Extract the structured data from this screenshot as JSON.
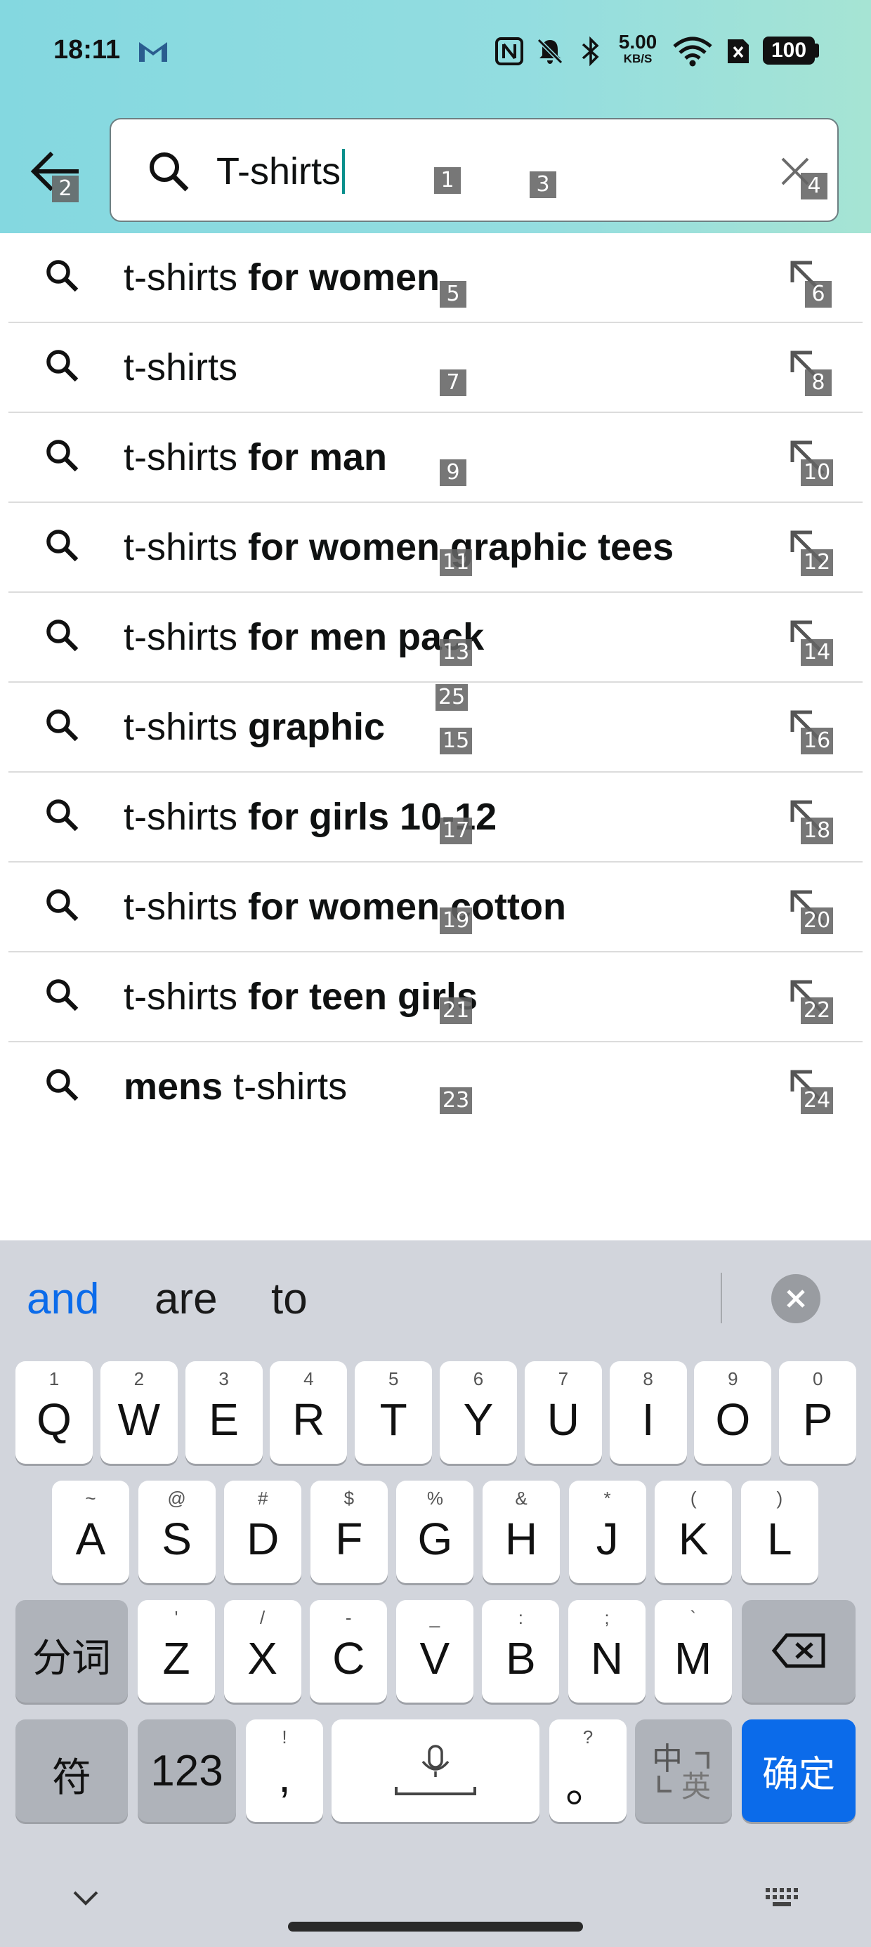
{
  "status_bar": {
    "time": "18:11",
    "speed_value": "5.00",
    "speed_unit": "KB/S",
    "battery": "100",
    "icons": [
      "gmail-icon",
      "nfc-icon",
      "mute-icon",
      "bluetooth-icon",
      "wifi-icon",
      "sim-icon",
      "battery-icon"
    ]
  },
  "search": {
    "query": "T-shirts",
    "back_icon": "back-arrow-icon",
    "search_icon": "search-icon",
    "clear_icon": "close-icon"
  },
  "suggestions": [
    {
      "plain": "t-shirts ",
      "bold": "for women"
    },
    {
      "plain": "t-shirts",
      "bold": ""
    },
    {
      "plain": "t-shirts ",
      "bold": "for man"
    },
    {
      "plain": "t-shirts ",
      "bold": "for women graphic tees"
    },
    {
      "plain": "t-shirts ",
      "bold": "for men pack"
    },
    {
      "plain": "t-shirts ",
      "bold": "graphic"
    },
    {
      "plain": "t-shirts ",
      "bold": "for girls 10-12"
    },
    {
      "plain": "t-shirts ",
      "bold": "for women cotton"
    },
    {
      "plain": "t-shirts ",
      "bold": "for teen girls"
    },
    {
      "bold_first": "mens ",
      "plain_after": "t-shirts"
    }
  ],
  "tags": [
    "1",
    "2",
    "3",
    "4",
    "5",
    "6",
    "7",
    "8",
    "9",
    "10",
    "11",
    "12",
    "13",
    "14",
    "15",
    "16",
    "17",
    "18",
    "19",
    "20",
    "21",
    "22",
    "23",
    "24",
    "25"
  ],
  "keyboard": {
    "candidates": [
      "and",
      "are",
      "to"
    ],
    "row1": [
      {
        "k": "Q",
        "s": "1"
      },
      {
        "k": "W",
        "s": "2"
      },
      {
        "k": "E",
        "s": "3"
      },
      {
        "k": "R",
        "s": "4"
      },
      {
        "k": "T",
        "s": "5"
      },
      {
        "k": "Y",
        "s": "6"
      },
      {
        "k": "U",
        "s": "7"
      },
      {
        "k": "I",
        "s": "8"
      },
      {
        "k": "O",
        "s": "9"
      },
      {
        "k": "P",
        "s": "0"
      }
    ],
    "row2": [
      {
        "k": "A",
        "s": "~"
      },
      {
        "k": "S",
        "s": "@"
      },
      {
        "k": "D",
        "s": "#"
      },
      {
        "k": "F",
        "s": "$"
      },
      {
        "k": "G",
        "s": "%"
      },
      {
        "k": "H",
        "s": "&"
      },
      {
        "k": "J",
        "s": "*"
      },
      {
        "k": "K",
        "s": "("
      },
      {
        "k": "L",
        "s": ")"
      }
    ],
    "row3": [
      {
        "k": "Z",
        "s": "'"
      },
      {
        "k": "X",
        "s": "/"
      },
      {
        "k": "C",
        "s": "-"
      },
      {
        "k": "V",
        "s": "_"
      },
      {
        "k": "B",
        "s": ":"
      },
      {
        "k": "N",
        "s": ";"
      },
      {
        "k": "M",
        "s": "`"
      }
    ],
    "segment_label": "分词",
    "symbol_label": "符",
    "numeric_label": "123",
    "comma_label": ",",
    "comma_sub": "!",
    "period_label": "。",
    "period_sub": "?",
    "lang_main": "中",
    "lang_sub": "英",
    "confirm_label": "确定"
  },
  "colors": {
    "accent_blue": "#0b6bea",
    "header_gradient_start": "#84d8e0",
    "header_gradient_end": "#a6e4d4",
    "caret": "#0a8f8c"
  }
}
